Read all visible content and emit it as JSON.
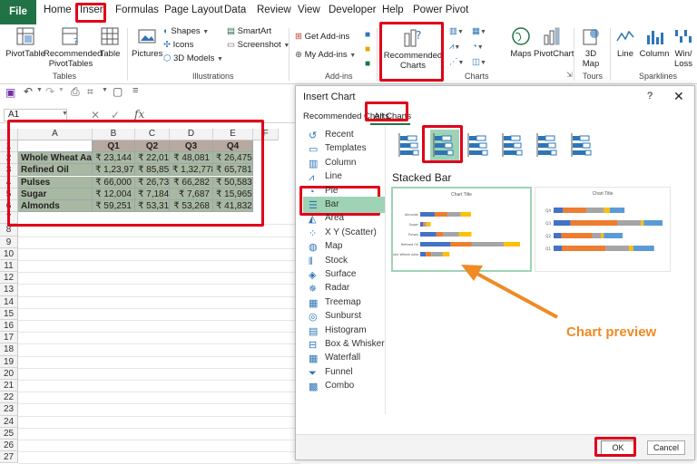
{
  "tabs": [
    "File",
    "Home",
    "Insert",
    "Formulas",
    "Page Layout",
    "Data",
    "Review",
    "View",
    "Developer",
    "Help",
    "Power Pivot"
  ],
  "ribbon": {
    "tables": {
      "pivot": "PivotTable",
      "recommended": "Recommended PivotTables",
      "table": "Table",
      "label": "Tables"
    },
    "illustrations": {
      "pictures": "Pictures",
      "shapes": "Shapes",
      "icons": "Icons",
      "models": "3D Models",
      "smartart": "SmartArt",
      "screenshot": "Screenshot",
      "label": "Illustrations"
    },
    "addins": {
      "get": "Get Add-ins",
      "my": "My Add-ins",
      "label": "Add-ins"
    },
    "charts": {
      "recommended": "Recommended Charts",
      "maps": "Maps",
      "pivotchart": "PivotChart",
      "label": "Charts"
    },
    "tours": {
      "map3d": "3D Map",
      "label": "Tours"
    },
    "sparklines": {
      "line": "Line",
      "column": "Column",
      "winloss": "Win/ Loss",
      "label": "Sparklines"
    }
  },
  "namebox": "A1",
  "fx": "fx",
  "grid": {
    "columns": [
      "A",
      "B",
      "C",
      "D",
      "E",
      "F"
    ],
    "headers": [
      "",
      "Q1",
      "Q2",
      "Q3",
      "Q4"
    ],
    "rows": [
      [
        "Whole Wheat Aata",
        "₹ 23,144",
        "₹ 22,012",
        "₹ 48,081",
        "₹ 26,475"
      ],
      [
        "Refined Oil",
        "₹ 1,23,973",
        "₹ 85,853",
        "₹ 1,32,778",
        "₹ 65,781"
      ],
      [
        "Pulses",
        "₹ 66,000",
        "₹ 26,737",
        "₹ 66,282",
        "₹ 50,583"
      ],
      [
        "Sugar",
        "₹ 12,004",
        "₹ 7,184",
        "₹ 7,687",
        "₹ 15,965"
      ],
      [
        "Almonds",
        "₹ 59,251",
        "₹ 53,311",
        "₹ 53,268",
        "₹ 41,832"
      ]
    ],
    "row_numbers": [
      "1",
      "2",
      "3",
      "4",
      "5",
      "6",
      "7",
      "8",
      "9",
      "10",
      "11",
      "12",
      "13",
      "14",
      "15",
      "16",
      "17",
      "18",
      "19",
      "20",
      "21",
      "22",
      "23",
      "24",
      "25",
      "26",
      "27"
    ]
  },
  "dialog": {
    "title": "Insert Chart",
    "help": "?",
    "close": "✕",
    "tab_recommended": "Recommended Charts",
    "tab_all": "All Charts",
    "types": [
      "Recent",
      "Templates",
      "Column",
      "Line",
      "Pie",
      "Bar",
      "Area",
      "X Y (Scatter)",
      "Map",
      "Stock",
      "Surface",
      "Radar",
      "Treemap",
      "Sunburst",
      "Histogram",
      "Box & Whisker",
      "Waterfall",
      "Funnel",
      "Combo"
    ],
    "selected_type": "Bar",
    "subtype_title": "Stacked Bar",
    "preview_title_1": "Chart Title",
    "preview_title_2": "Chart Title",
    "ok": "OK",
    "cancel": "Cancel"
  },
  "annotation": "Chart preview",
  "colors": {
    "excel_green": "#217346",
    "highlight_red": "#e0001a",
    "arrow_orange": "#f08a24",
    "header_fill": "#b8a9a0",
    "row_fill": "#a9b8a2",
    "bar_select": "#9ed3b6"
  }
}
